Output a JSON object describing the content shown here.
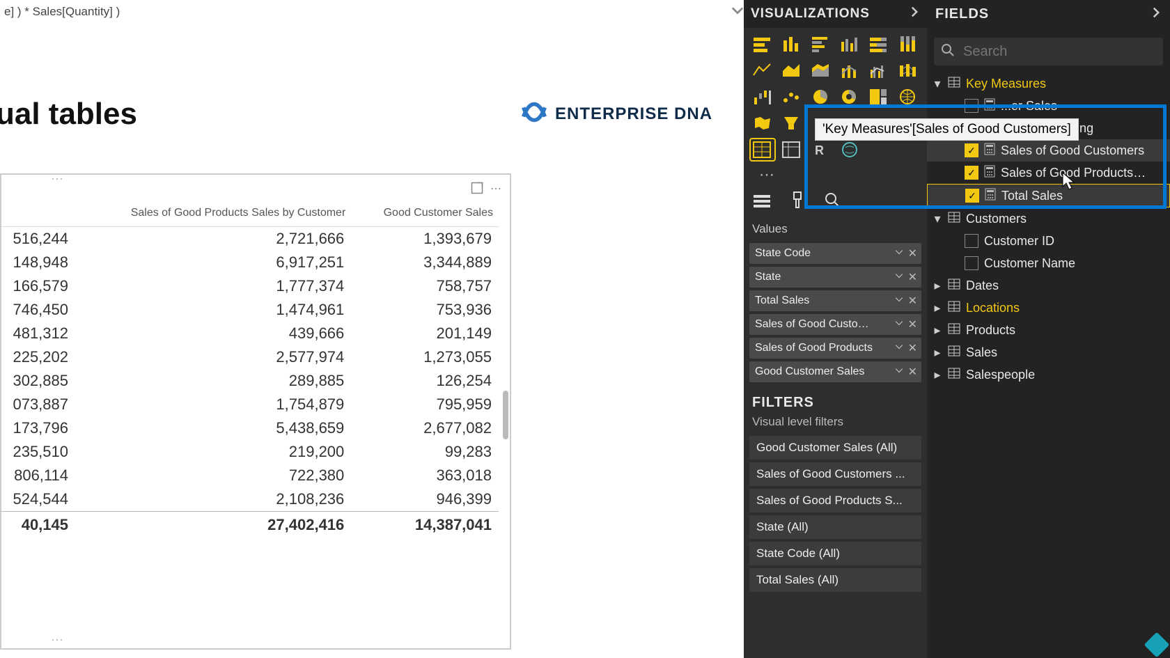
{
  "formula_bar": {
    "text": "e] ) * Sales[Quantity] )"
  },
  "canvas": {
    "title": "ual tables",
    "logo": "ENTERPRISE DNA"
  },
  "table": {
    "headers": [
      "",
      "Sales of Good Products Sales by Customer",
      "Good Customer Sales"
    ],
    "rows": [
      [
        "516,244",
        "2,721,666",
        "1,393,679"
      ],
      [
        "148,948",
        "6,917,251",
        "3,344,889"
      ],
      [
        "166,579",
        "1,777,374",
        "758,757"
      ],
      [
        "746,450",
        "1,474,961",
        "753,936"
      ],
      [
        "481,312",
        "439,666",
        "201,149"
      ],
      [
        "225,202",
        "2,577,974",
        "1,273,055"
      ],
      [
        "302,885",
        "289,885",
        "126,254"
      ],
      [
        "073,887",
        "1,754,879",
        "795,959"
      ],
      [
        "173,796",
        "5,438,659",
        "2,677,082"
      ],
      [
        "235,510",
        "219,200",
        "99,283"
      ],
      [
        "806,114",
        "722,380",
        "363,018"
      ],
      [
        "524,544",
        "2,108,236",
        "946,399"
      ]
    ],
    "total": [
      "40,145",
      "27,402,416",
      "14,387,041"
    ]
  },
  "vis": {
    "title": "VISUALIZATIONS",
    "values_label": "Values",
    "pills": [
      "State Code",
      "State",
      "Total Sales",
      "Sales of Good Customers",
      "Sales of Good Products",
      "Good Customer Sales"
    ],
    "filters_title": "FILTERS",
    "filters_sub": "Visual level filters",
    "filters": [
      "Good Customer Sales  (All)",
      "Sales of Good Customers ...",
      "Sales of Good Products S...",
      "State  (All)",
      "State Code  (All)",
      "Total Sales  (All)"
    ]
  },
  "tooltip": "'Key Measures'[Sales of Good Customers]",
  "fields": {
    "title": "FIELDS",
    "search_placeholder": "Search",
    "tables": {
      "key_measures": {
        "label": "Key Measures",
        "items": [
          {
            "label": "...er Sales",
            "checked": false
          },
          {
            "label": "Product Ranking",
            "checked": false
          },
          {
            "label": "Sales of Good Customers",
            "checked": true
          },
          {
            "label": "Sales of Good Products Sa...",
            "checked": true
          },
          {
            "label": "Total Sales",
            "checked": true
          }
        ]
      },
      "customers": {
        "label": "Customers",
        "items": [
          {
            "label": "Customer ID",
            "checked": false
          },
          {
            "label": "Customer Name",
            "checked": false
          }
        ]
      },
      "other": [
        "Dates",
        "Locations",
        "Products",
        "Sales",
        "Salespeople"
      ]
    }
  }
}
